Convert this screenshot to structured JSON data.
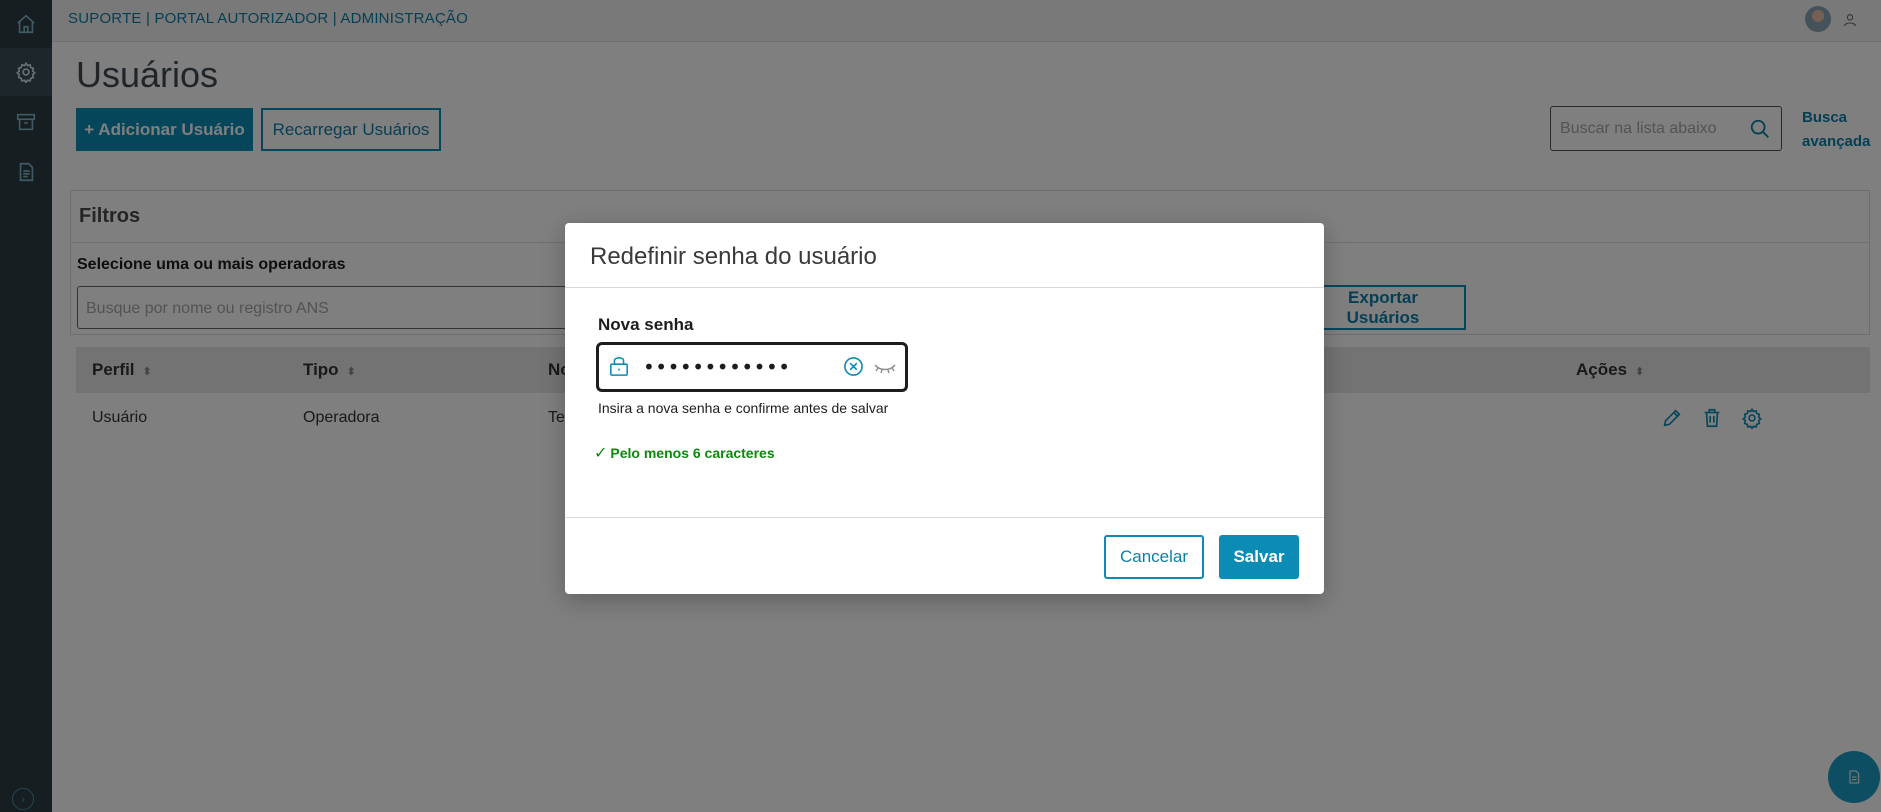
{
  "topbar": {
    "breadcrumb": "SUPORTE | PORTAL AUTORIZADOR | ADMINISTRAÇÃO"
  },
  "sidebar": {
    "items": [
      {
        "icon": "home-icon"
      },
      {
        "icon": "gear-icon",
        "active": true
      },
      {
        "icon": "archive-icon"
      },
      {
        "icon": "document-icon"
      }
    ]
  },
  "page": {
    "title": "Usuários",
    "add_button": "+ Adicionar Usuário",
    "reload_button": "Recarregar Usuários",
    "search_placeholder": "Buscar na lista abaixo",
    "advanced_search_line1": "Busca",
    "advanced_search_line2": "avançada"
  },
  "filters": {
    "title": "Filtros",
    "operators_label": "Selecione uma ou mais operadoras",
    "operators_placeholder": "Busque por nome ou registro ANS",
    "export_button": "Exportar Usuários"
  },
  "table": {
    "columns": [
      "Perfil",
      "Tipo",
      "No",
      "Ações"
    ],
    "rows": [
      {
        "perfil": "Usuário",
        "tipo": "Operadora",
        "nome": "Te"
      }
    ]
  },
  "modal": {
    "title": "Redefinir senha do usuário",
    "field_label": "Nova senha",
    "password_value": "••••••••••••",
    "helper_text": "Insira a nova senha e confirme antes de salvar",
    "rule_check": "✓",
    "rule_text": "Pelo menos 6 caracteres",
    "cancel_button": "Cancelar",
    "save_button": "Salvar"
  },
  "colors": {
    "accent": "#0c8cb4",
    "sidebar": "#2c3c44",
    "success": "#0b8a0b"
  }
}
